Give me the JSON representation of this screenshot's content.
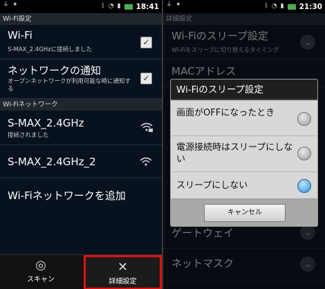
{
  "left": {
    "status": {
      "time": "18:41"
    },
    "section_wifi_settings": "Wi-Fi設定",
    "wifi_row": {
      "title": "Wi-Fi",
      "subtitle": "S-MAX_2.4GHzに接続しました"
    },
    "notify_row": {
      "title": "ネットワークの通知",
      "subtitle": "オープンネットワークが利用可能な時に通知する"
    },
    "section_networks": "Wi-Fiネットワーク",
    "networks": [
      {
        "ssid": "S-MAX_2.4GHz",
        "status": "接続されました"
      },
      {
        "ssid": "S-MAX_2.4GHz_2",
        "status": ""
      }
    ],
    "add_network": "Wi-Fiネットワークを追加",
    "bottom_tabs": {
      "scan": "スキャン",
      "advanced": "詳細設定"
    }
  },
  "right": {
    "status": {
      "time": "21:30"
    },
    "section_advanced": "詳細設定",
    "sleep_row": {
      "title": "Wi-Fiのスリープ設定",
      "subtitle": "Wi-Fiをスリープに切り替えるタイミング"
    },
    "mac_row": {
      "title": "MACアドレス"
    },
    "partial_row": "ゲートウェイ",
    "netmask_row": "ネットマスク",
    "dialog": {
      "title": "Wi-Fiのスリープ設定",
      "options": [
        {
          "label": "画面がOFFになったとき",
          "selected": false
        },
        {
          "label": "電源接続時はスリープにしない",
          "selected": false
        },
        {
          "label": "スリープにしない",
          "selected": true
        }
      ],
      "cancel": "キャンセル"
    }
  },
  "colors": {
    "selected_tab_border": "#e01010",
    "radio_selected": "#2f8fd6"
  }
}
